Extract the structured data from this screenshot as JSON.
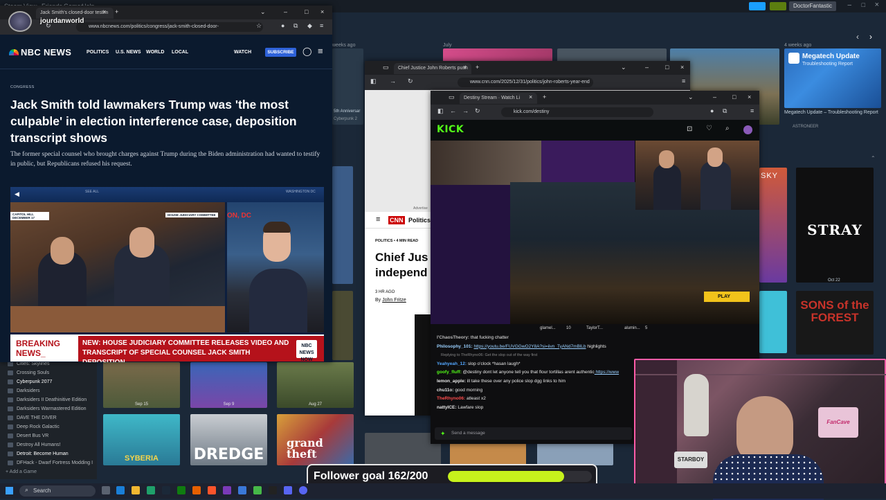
{
  "steam": {
    "menu": [
      "Steam",
      "View",
      "Friends",
      "Games",
      "Help"
    ],
    "username": "DoctorFantastic",
    "recent_labels": [
      "weeks ago",
      "July",
      "4 weeks ago"
    ],
    "megatech_title": "Megatech Update",
    "megatech_sub": "Troubleshooting Report",
    "megatech_caption": "Megatech Update – Troubleshooting Report",
    "megatech_author": "ASTRONEER",
    "anniversary_caption": "5th Anniversar",
    "cyberpunk_caption": "Cyberpunk 2",
    "date_oct22": "Oct 22",
    "date_sep15": "Sep 15",
    "date_sep9": "Sep 9",
    "date_aug27": "Aug 27",
    "no_mans_sky": "SKY",
    "stray": "STRAY",
    "sons_forest": "SONS of the FOREST",
    "dredge": "DREDGE",
    "gta": "grand theft",
    "syberia": "SYBERIA",
    "sidebar_items": [
      "Cities: Skylines",
      "Crossing Souls",
      "Cyberpunk 2077",
      "Darksiders",
      "Darksiders II Deathinitive Edition",
      "Darksiders Warmastered Edition",
      "DAVE THE DIVER",
      "Deep Rock Galactic",
      "Desert Bus VR",
      "Destroy All Humans!",
      "Detroit: Become Human",
      "DFHack - Dwarf Fortress Modding I"
    ],
    "add_game": "Add a Game"
  },
  "overlay_user": "jourdanworld",
  "nbc": {
    "tab_title": "Jack Smith's closed-door testim",
    "url": "www.nbcnews.com/politics/congress/jack-smith-closed-door-",
    "logo": "NBC NEWS",
    "nav": [
      "POLITICS",
      "U.S. NEWS",
      "WORLD",
      "LOCAL"
    ],
    "watch": "WATCH",
    "subscribe": "SUBSCRIBE",
    "kicker": "CONGRESS",
    "headline": "Jack Smith told lawmakers Trump was 'the most culpable' in election interference case, deposition transcript shows",
    "dek": "The former special counsel who brought charges against Trump during the Biden administration had wanted to testify in public, but Republicans refused his request.",
    "video_see_all": "SEE ALL",
    "video_loc": "WASHINGTON DC",
    "chyron_left": "CAPITOL HILL DECEMBER 17",
    "chyron_committee": "HOUSE JUDICIARY COMMITTEE",
    "inset_loc": "ON, DC",
    "breaking": "BREAKING NEWS_",
    "breaking_text": "NEW: HOUSE JUDICIARY COMMITTEE RELEASES VIDEO AND TRANSCRIPT OF SPECIAL COUNSEL JACK SMITH DEPOSITION",
    "nbc_now": "NBC NEWS NOW"
  },
  "cnn": {
    "tab_title": "Chief Justice John Roberts push",
    "url": "www.cnn.com/2025/12/31/politics/john-roberts-year-end",
    "ad_label": "Advertise",
    "logo": "CNN",
    "section": "Politics",
    "kicker": "POLITICS • 4 MIN READ",
    "headline_1": "Chief Jus",
    "headline_2": "independ",
    "age": "3 HR AGO",
    "by": "By",
    "author": "John Fritze"
  },
  "kick": {
    "tab_title": "Destiny Stream · Watch Li",
    "url": "kick.com/destiny",
    "logo": "KICK",
    "play": "PLAY",
    "viewers": [
      "glamel...",
      "TaylorT...",
      "alumin..."
    ],
    "viewer_counts": [
      "10",
      "",
      "5"
    ],
    "chat": [
      {
        "user": "l'ChaosTheory:",
        "msg": "that fucking chatter",
        "color": "#b9b9b9"
      },
      {
        "user": "Philosophy_101:",
        "msg": "https://youtu.be/FUVGGwO2Y8A?si=iivn_TyANd7mBlLb",
        "tail": "highlights",
        "color": "#9ad0ff",
        "link": true
      },
      {
        "user": "",
        "msg": "Replying to TheRhyno06: Get the slop out of the way first",
        "color": "#888",
        "reply": true
      },
      {
        "user": "Yeahyeah_12:",
        "msg": "slop o'clock *hasan laugh*",
        "color": "#53a7ff"
      },
      {
        "user": "goofy_fluff:",
        "msg": "@destiny dont let anyone tell you that flour tortillas arent authentic",
        "tail": "https://www",
        "color": "#53fc18"
      },
      {
        "user": "lemon_apple:",
        "msg": "ill take these over any police slop dgg links to him",
        "color": "#e6e6e6"
      },
      {
        "user": "chu11o:",
        "msg": "good morning",
        "color": "#e6e6e6"
      },
      {
        "user": "TheRhyno06:",
        "msg": "atleast x2",
        "color": "#ff4d4d"
      },
      {
        "user": "nattyICE:",
        "msg": "Lawfare slop",
        "color": "#e6e6e6"
      }
    ],
    "send_placeholder": "Send a message"
  },
  "webcam": {
    "shirt_text": "STARBOY",
    "sign": "FanCave"
  },
  "follower_goal": {
    "label": "Follower goal 162/200",
    "current": 162,
    "target": 200,
    "fill_color": "#c7f21c"
  },
  "taskbar": {
    "search": "Search"
  }
}
